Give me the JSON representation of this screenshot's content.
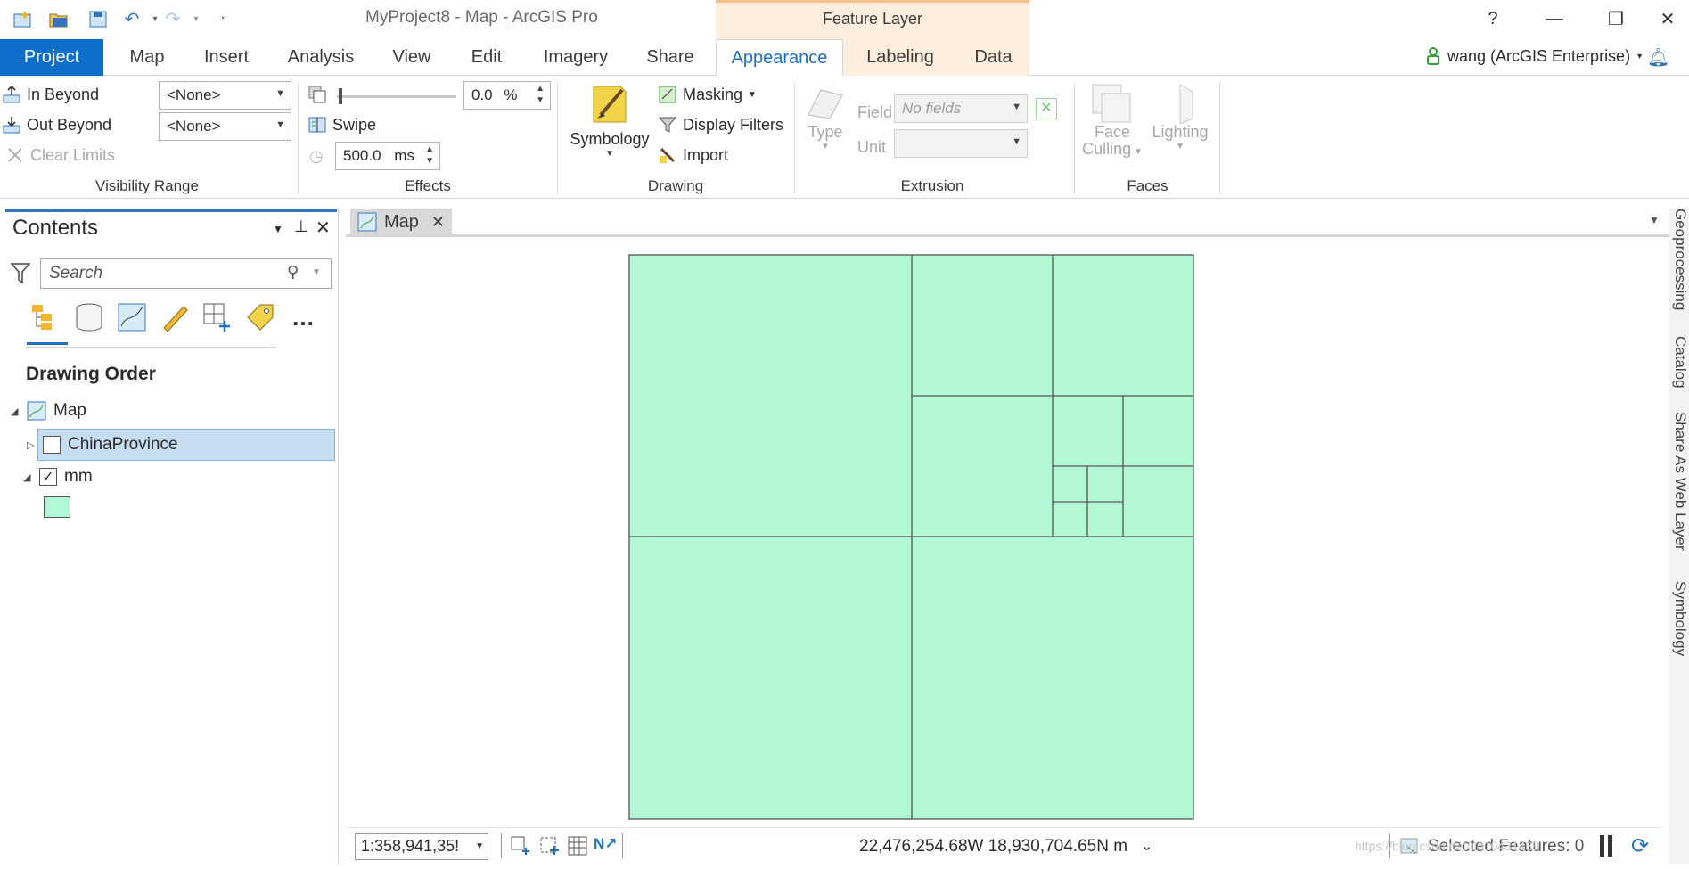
{
  "title_bar": {
    "app_title": "MyProject8 - Map - ArcGIS Pro",
    "context_group": "Feature Layer",
    "help": "?",
    "minimize": "—",
    "restore": "❐",
    "close": "✕"
  },
  "tabs": [
    {
      "label": "Project"
    },
    {
      "label": "Map"
    },
    {
      "label": "Insert"
    },
    {
      "label": "Analysis"
    },
    {
      "label": "View"
    },
    {
      "label": "Edit"
    },
    {
      "label": "Imagery"
    },
    {
      "label": "Share"
    },
    {
      "label": "Appearance"
    },
    {
      "label": "Labeling"
    },
    {
      "label": "Data"
    }
  ],
  "user": {
    "name": "wang (ArcGIS Enterprise)"
  },
  "ribbon": {
    "visibility": {
      "in_beyond": "In Beyond",
      "out_beyond": "Out Beyond",
      "clear_limits": "Clear Limits",
      "in_value": "<None>",
      "out_value": "<None>",
      "label": "Visibility Range"
    },
    "effects": {
      "transparency_value": "0.0",
      "transparency_unit": "%",
      "swipe": "Swipe",
      "flicker_value": "500.0",
      "flicker_unit": "ms",
      "label": "Effects"
    },
    "drawing": {
      "symbology": "Symbology",
      "masking": "Masking",
      "display_filters": "Display Filters",
      "import": "Import",
      "label": "Drawing"
    },
    "extrusion": {
      "type": "Type",
      "field_label": "Field",
      "field_value": "No fields",
      "unit_label": "Unit",
      "unit_value": "",
      "label": "Extrusion"
    },
    "faces": {
      "face_culling": "Face\nCulling",
      "face_line1": "Face",
      "face_line2": "Culling",
      "lighting": "Lighting",
      "label": "Faces"
    }
  },
  "contents": {
    "title": "Contents",
    "search_placeholder": "Search",
    "section": "Drawing Order",
    "tree": [
      {
        "label": "Map",
        "checked": null
      },
      {
        "label": "ChinaProvince",
        "checked": false,
        "selected": true
      },
      {
        "label": "mm",
        "checked": true
      }
    ],
    "symbol_color": "#b3f8d4"
  },
  "map": {
    "tab_label": "Map",
    "fill_color": "#b3f8d4",
    "stroke_color": "#555555",
    "scale": "1:358,941,35!",
    "coordinates": "22,476,254.68W 18,930,704.65N m",
    "selected_features": "Selected Features: 0"
  },
  "right_dock": [
    "Geoprocessing",
    "Catalog",
    "Share As Web Layer",
    "Symbology"
  ],
  "watermark": "https://blog.csdn.net/u010431439",
  "colors": {
    "accent": "#0d6fc9",
    "context_tab": "#fdeedd"
  }
}
